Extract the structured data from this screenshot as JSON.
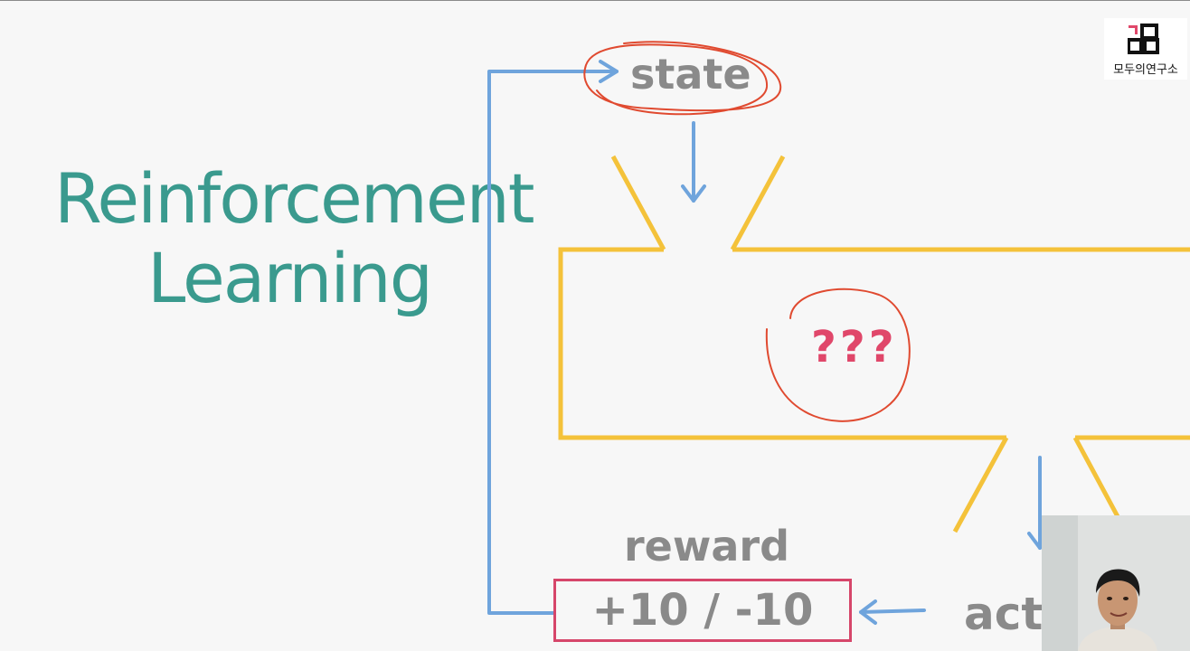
{
  "slide": {
    "title_line1": "Reinforcement",
    "title_line2": "Learning",
    "state": "state",
    "unknown": "???",
    "reward_label": "reward",
    "reward_value": "+10 / -10",
    "action_partial": "acti"
  },
  "logo": {
    "text": "모두의연구소"
  },
  "colors": {
    "title": "#3a9a8e",
    "agent_box": "#f4c23a",
    "arrows": "#6fa4dc",
    "annotation": "#e04a30",
    "reward_box": "#d6466a",
    "question": "#e0476a",
    "labels": "#8a8a8a"
  },
  "icons": {
    "logo_mark": "modu-lab-logo-icon",
    "presenter": "presenter-webcam"
  }
}
